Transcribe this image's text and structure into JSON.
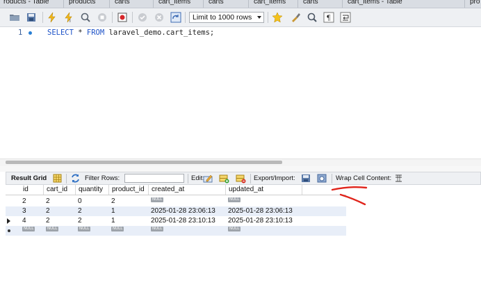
{
  "tabs": [
    "roducts - Table",
    "products",
    "carts",
    "cart_items",
    "carts",
    "cart_items",
    "carts",
    "cart_items - Table",
    "pro"
  ],
  "toolbar": {
    "limit_label": "Limit to 1000 rows",
    "icons": [
      "open-folder-icon",
      "save-icon",
      "execute-icon",
      "execute-current-icon",
      "explain-icon",
      "stop-icon",
      "toggle-error-icon",
      "commit-icon",
      "rollback-icon",
      "autocommit-icon",
      "beautify-icon",
      "find-icon",
      "invisible-chars-icon",
      "wrap-icon"
    ]
  },
  "editor": {
    "line_number": "1",
    "kw_select": "SELECT",
    "star": " * ",
    "kw_from": "FROM",
    "rest": " laravel_demo.cart_items;"
  },
  "result_toolbar": {
    "result_grid": "Result Grid",
    "filter_rows": "Filter Rows:",
    "edit": "Edit:",
    "export_import": "Export/Import:",
    "wrap_cell": "Wrap Cell Content:"
  },
  "grid": {
    "columns": [
      "id",
      "cart_id",
      "quantity",
      "product_id",
      "created_at",
      "updated_at"
    ],
    "null_text": "NULL",
    "rows": [
      {
        "id": "2",
        "cart_id": "2",
        "quantity": "0",
        "product_id": "2",
        "created_at": null,
        "updated_at": null
      },
      {
        "id": "3",
        "cart_id": "2",
        "quantity": "2",
        "product_id": "1",
        "created_at": "2025-01-28 23:06:13",
        "updated_at": "2025-01-28 23:06:13"
      },
      {
        "id": "4",
        "cart_id": "2",
        "quantity": "2",
        "product_id": "1",
        "created_at": "2025-01-28 23:10:13",
        "updated_at": "2025-01-28 23:10:13"
      },
      {
        "id": null,
        "cart_id": null,
        "quantity": null,
        "product_id": null,
        "created_at": null,
        "updated_at": null
      }
    ]
  },
  "colors": {
    "keyword": "#1d52c7",
    "annotation": "#e0241b",
    "row_alt": "#e8eef8"
  }
}
